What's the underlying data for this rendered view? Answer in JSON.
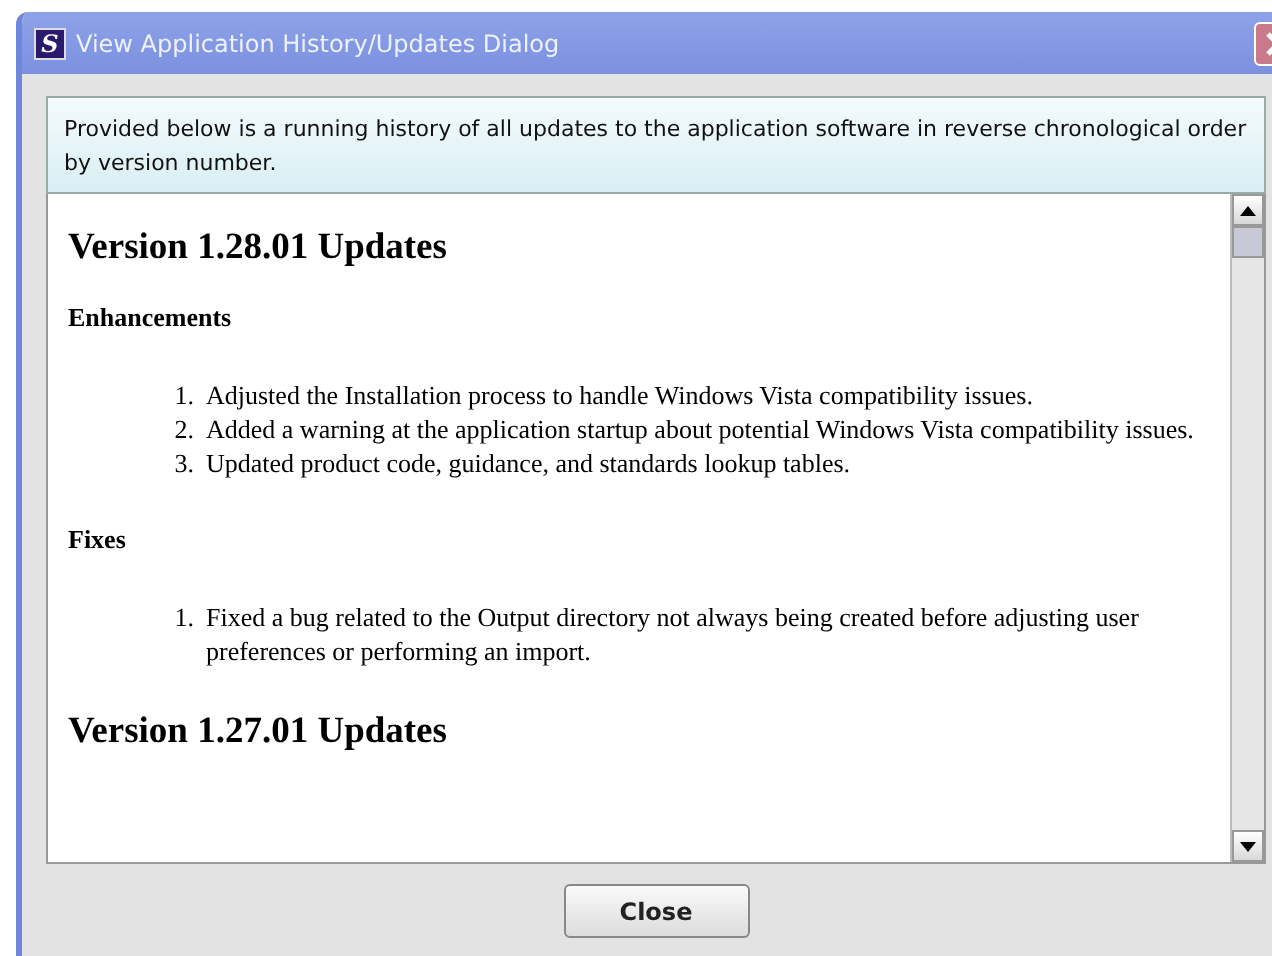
{
  "window": {
    "title": "View Application History/Updates Dialog",
    "logo": "S"
  },
  "intro": "Provided below is a running history of all updates to the application software in reverse chronological order by version number.",
  "versions": [
    {
      "heading": "Version 1.28.01 Updates",
      "sections": [
        {
          "heading": "Enhancements",
          "items": [
            {
              "number": "1.",
              "text": "Adjusted the Installation process to handle Windows Vista compatibility issues."
            },
            {
              "number": "2.",
              "text": "Added a warning at the application startup about potential Windows Vista compatibility issues."
            },
            {
              "number": "3.",
              "text": "Updated product code, guidance, and standards lookup tables."
            }
          ]
        },
        {
          "heading": "Fixes",
          "items": [
            {
              "number": "1.",
              "text": "Fixed a bug related to the Output directory not always being created before adjusting user preferences or performing an import."
            }
          ]
        }
      ]
    },
    {
      "heading": "Version 1.27.01 Updates"
    }
  ],
  "buttons": [
    "Close"
  ]
}
